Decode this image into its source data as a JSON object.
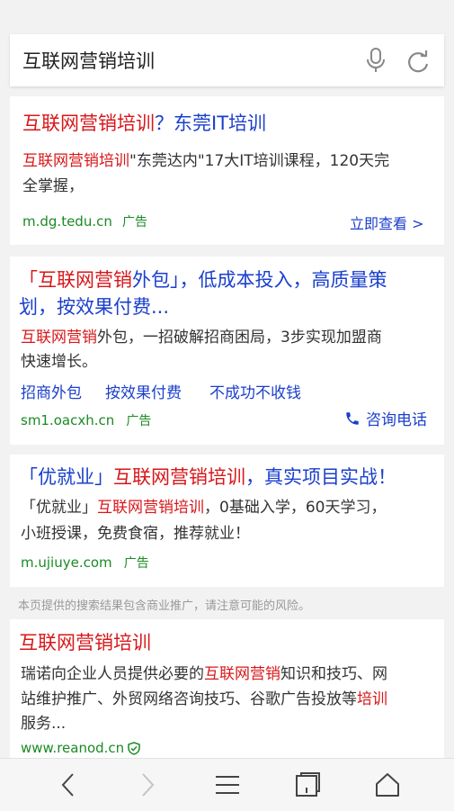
{
  "search": {
    "query": "互联网营销培训"
  },
  "results": [
    {
      "title": [
        "互联网营销培训",
        "？东莞IT培训"
      ],
      "desc_line1": [
        "互联网营销培训",
        "\"东莞达内\"17大IT培训课程，120天完"
      ],
      "desc_line2": "全掌握，",
      "url": "m.dg.tedu.cn",
      "ad_label": "广告",
      "action": "立即查看 >"
    },
    {
      "title_line1": [
        "「互联网营销",
        "外包」，低成本投入，高质量策"
      ],
      "title_line2": "划，按效果付费...",
      "desc_line1": [
        "互联网营销",
        "外包，一招破解招商困局，3步实现加盟商"
      ],
      "desc_line2": "快速增长。",
      "sitelinks": [
        "招商外包",
        "按效果付费",
        "不成功不收钱"
      ],
      "url": "sm1.oacxh.cn",
      "ad_label": "广告",
      "action": "咨询电话"
    },
    {
      "title": [
        "「优就业」",
        "互联网营销培训",
        "，真实项目实战！"
      ],
      "desc_line1": [
        "「优就业」",
        "互联网营销培训",
        "，0基础入学，60天学习，"
      ],
      "desc_line2": "小班授课，免费食宿，推荐就业！",
      "url": "m.ujiuye.com",
      "ad_label": "广告"
    },
    {
      "title": "互联网营销培训",
      "desc_line1": [
        "瑞诺向企业人员提供必要的",
        "互联网营销",
        "知识和技巧、网"
      ],
      "desc_line2": [
        "站维护推广、外贸网络咨询技巧、谷歌广告投放等",
        "培训"
      ],
      "desc_line3": "服务...",
      "url": "www.reanod.cn"
    }
  ],
  "notice": "本页提供的搜索结果包含商业推广，请注意可能的风险。",
  "icons": {
    "mic": "mic-icon",
    "refresh": "refresh-icon",
    "phone": "phone-icon",
    "verified": "verified-shield-icon",
    "back": "back-arrow-icon",
    "forward": "forward-arrow-icon",
    "menu": "menu-icon",
    "tabs": "tabs-icon",
    "home": "home-icon"
  },
  "colors": {
    "title_blue": "#1a3fcc",
    "highlight_red": "#d8171a",
    "url_green": "#1b8a24"
  }
}
